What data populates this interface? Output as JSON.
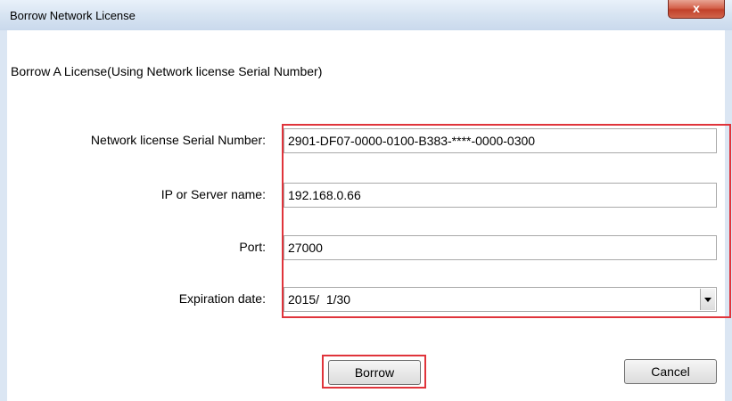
{
  "window": {
    "title": "Borrow Network License",
    "close_glyph": "x"
  },
  "heading": "Borrow A License(Using Network license Serial Number)",
  "fields": {
    "serial": {
      "label": "Network license Serial Number:",
      "value": "2901-DF07-0000-0100-B383-****-0000-0300"
    },
    "server": {
      "label": "IP or Server name:",
      "value": "192.168.0.66"
    },
    "port": {
      "label": "Port:",
      "value": "27000"
    },
    "expiration": {
      "label": "Expiration date:",
      "value": "2015/  1/30"
    }
  },
  "buttons": {
    "borrow": "Borrow",
    "cancel": "Cancel"
  },
  "colors": {
    "highlight": "#e0343b",
    "titlebar": "#d7e4f2",
    "close": "#c2412a"
  },
  "icons": {
    "close": "close-icon",
    "dropdown": "chevron-down-icon"
  }
}
